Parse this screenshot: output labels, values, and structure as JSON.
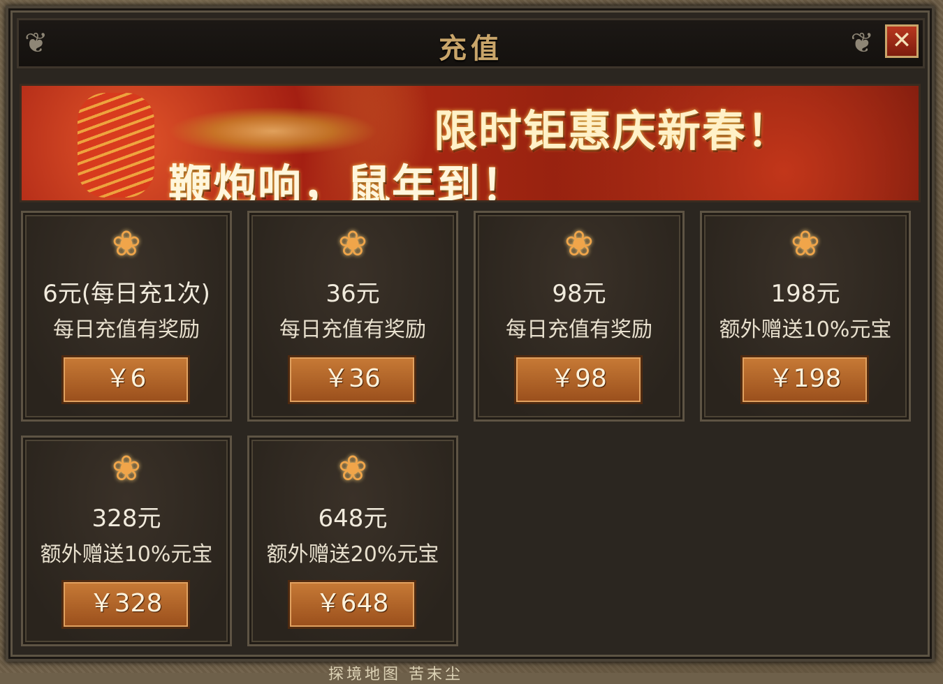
{
  "window": {
    "title": "充值",
    "close_label": "✕",
    "ornament_left": "❦",
    "ornament_right": "❦"
  },
  "banner": {
    "headline": "限时钜惠庆新春！",
    "subheadline": "鞭炮响，鼠年到！"
  },
  "packages": [
    {
      "icon": "lotus-icon",
      "price": "6元(每日充1次)",
      "desc": "每日充值有奖励",
      "button": "￥6"
    },
    {
      "icon": "lotus-icon",
      "price": "36元",
      "desc": "每日充值有奖励",
      "button": "￥36"
    },
    {
      "icon": "lotus-icon",
      "price": "98元",
      "desc": "每日充值有奖励",
      "button": "￥98"
    },
    {
      "icon": "lotus-icon",
      "price": "198元",
      "desc": "额外赠送10%元宝",
      "button": "￥198"
    },
    {
      "icon": "lotus-icon",
      "price": "328元",
      "desc": "额外赠送10%元宝",
      "button": "￥328"
    },
    {
      "icon": "lotus-icon",
      "price": "648元",
      "desc": "额外赠送20%元宝",
      "button": "￥648"
    }
  ],
  "icon_glyph": "❀",
  "colors": {
    "accent_gold": "#c9a56a",
    "button_orange": "#c77a36",
    "close_red": "#b8371f",
    "banner_red": "#b02a14"
  },
  "background_text": "探境地图 苦末尘"
}
